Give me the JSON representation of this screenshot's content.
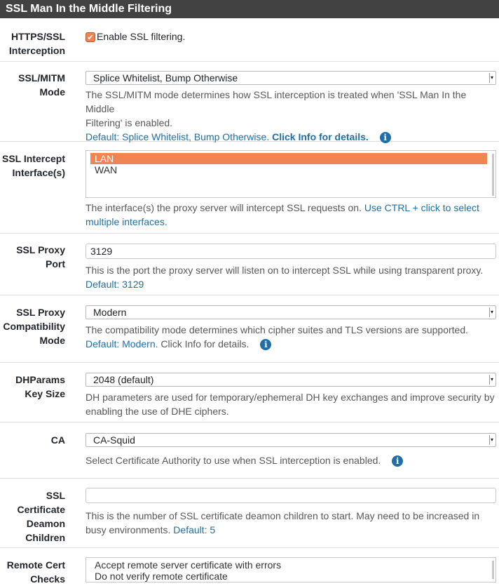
{
  "panel": {
    "title": "SSL Man In the Middle Filtering"
  },
  "interception": {
    "label_line1": "HTTPS/SSL",
    "label_line2": "Interception",
    "checkbox_label": "Enable SSL filtering."
  },
  "mitm_mode": {
    "label_line1": "SSL/MITM",
    "label_line2": "Mode",
    "selected": "Splice Whitelist, Bump Otherwise",
    "help_line1": "The SSL/MITM mode determines how SSL interception is treated when 'SSL Man In the Middle",
    "help_line2": "Filtering' is enabled.",
    "default_text": "Default: Splice Whitelist, Bump Otherwise.",
    "info_text": "Click Info for details."
  },
  "interfaces": {
    "label_line1": "SSL Intercept",
    "label_line2": "Interface(s)",
    "options": [
      "LAN",
      "WAN"
    ],
    "help_text": "The interface(s) the proxy server will intercept SSL requests on.",
    "help_hint_line1": "Use CTRL + click to select",
    "help_hint_line2": "multiple interfaces."
  },
  "proxy_port": {
    "label_line1": "SSL Proxy",
    "label_line2": "Port",
    "value": "3129",
    "help": "This is the port the proxy server will listen on to intercept SSL while using transparent proxy.",
    "default_text": "Default: 3129"
  },
  "compat_mode": {
    "label_line1": "SSL Proxy",
    "label_line2": "Compatibility",
    "label_line3": "Mode",
    "selected": "Modern",
    "help": "The compatibility mode determines which cipher suites and TLS versions are supported.",
    "default_text": "Default: Modern.",
    "info_text": "Click Info for details."
  },
  "dhparams": {
    "label_line1": "DHParams",
    "label_line2": "Key Size",
    "selected": "2048 (default)",
    "help_line1": "DH parameters are used for temporary/ephemeral DH key exchanges and improve security by",
    "help_line2": "enabling the use of DHE ciphers."
  },
  "ca": {
    "label": "CA",
    "selected": "CA-Squid",
    "help": "Select Certificate Authority to use when SSL interception is enabled."
  },
  "cert_daemon": {
    "label_line1": "SSL",
    "label_line2": "Certificate",
    "label_line3": "Deamon",
    "label_line4": "Children",
    "value": "",
    "help_line1": "This is the number of SSL certificate deamon children to start. May need to be increased in",
    "help_line2": "busy environments.",
    "default_text": "Default: 5"
  },
  "remote_cert": {
    "label_line1": "Remote Cert",
    "label_line2": "Checks",
    "options": [
      "Accept remote server certificate with errors",
      "Do not verify remote certificate"
    ]
  },
  "icons": {
    "info": "info-icon",
    "checkmark": "checkmark-icon",
    "dropdown": "chevron-down-icon"
  },
  "colors": {
    "header_bg": "#424242",
    "accent": "#f08453",
    "link": "#1f6fa6"
  }
}
